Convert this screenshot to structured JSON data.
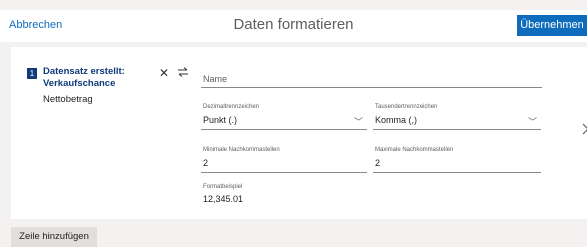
{
  "header": {
    "cancel_label": "Abbrechen",
    "title": "Daten formatieren",
    "apply_label": "Übernehmen"
  },
  "step": {
    "number": "1",
    "title": "Datensatz erstellt: Verkaufschance",
    "subtitle": "Nettobetrag"
  },
  "form": {
    "name_placeholder": "Name",
    "decimal_separator": {
      "label": "Dezimaltrennzeichen",
      "value": "Punkt (.)"
    },
    "thousands_separator": {
      "label": "Tausendertrennzeichen",
      "value": "Komma (,)"
    },
    "min_decimals": {
      "label": "Minimale Nachkommastellen",
      "value": "2"
    },
    "max_decimals": {
      "label": "Maximale Nachkommastellen",
      "value": "2"
    },
    "format_example": {
      "label": "Formatbeispiel",
      "value": "12,345.01"
    }
  },
  "footer": {
    "add_row_label": "Zeile hinzufügen"
  },
  "colors": {
    "accent": "#0f6cbd",
    "step_badge": "#0f3b7a",
    "background": "#f3f2f1"
  },
  "icons": [
    "close-icon",
    "swap-arrows-icon",
    "chevron-down-icon"
  ]
}
